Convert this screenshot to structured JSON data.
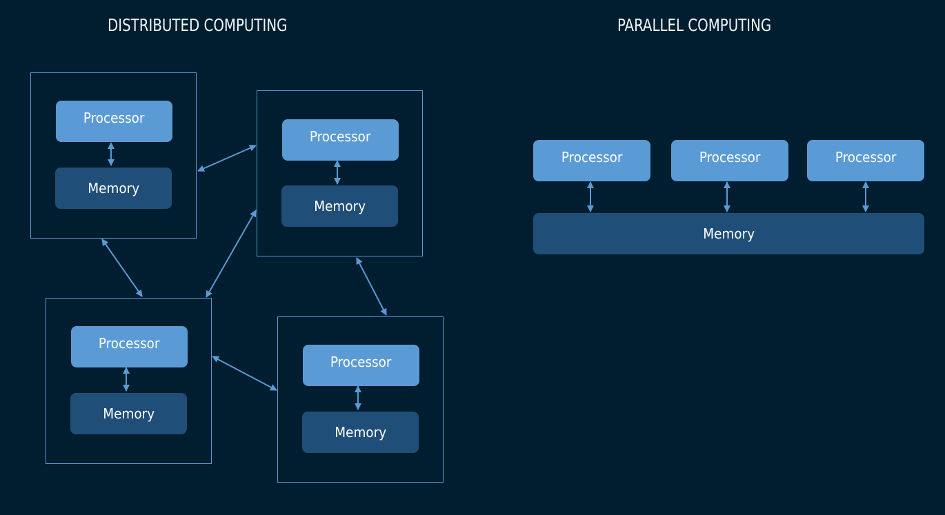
{
  "distributed": {
    "title": "DISTRIBUTED COMPUTING",
    "nodes": [
      {
        "processor": "Processor",
        "memory": "Memory"
      },
      {
        "processor": "Processor",
        "memory": "Memory"
      },
      {
        "processor": "Processor",
        "memory": "Memory"
      },
      {
        "processor": "Processor",
        "memory": "Memory"
      }
    ],
    "links": [
      [
        "node-1",
        "node-2"
      ],
      [
        "node-1",
        "node-3"
      ],
      [
        "node-2",
        "node-3"
      ],
      [
        "node-2",
        "node-4"
      ],
      [
        "node-3",
        "node-4"
      ]
    ]
  },
  "parallel": {
    "title": "PARALLEL COMPUTING",
    "processors": [
      "Processor",
      "Processor",
      "Processor"
    ],
    "memory": "Memory"
  },
  "colors": {
    "background": "#011d30",
    "processor": "#5b9bd5",
    "memory": "#1f4e79",
    "line": "#5b9bd5"
  }
}
